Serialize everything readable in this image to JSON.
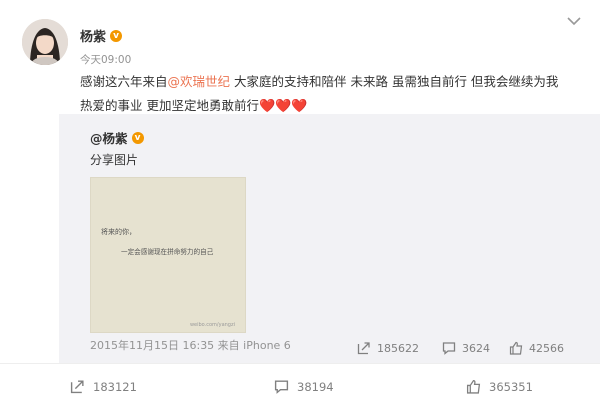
{
  "post": {
    "username": "杨紫",
    "time": "今天09:00",
    "text_before": "感谢这六年来自",
    "mention": "@欢瑞世纪",
    "text_after_line1": " 大家庭的支持和陪伴 未来路 虽需独自前行 但我会继续为我",
    "text_line2": "热爱的事业 更加坚定地勇敢前行",
    "hearts": "❤️❤️❤️"
  },
  "original": {
    "author": "@杨紫",
    "text": "分享图片",
    "image_line1": "将来的你，",
    "image_line2": "一定会感谢现在拼命努力的自己",
    "image_watermark": "weibo.com/yangzi",
    "date": "2015年11月15日 16:35 来自 iPhone 6",
    "reposts": "185622",
    "comments": "3624",
    "likes": "42566"
  },
  "footer": {
    "reposts": "183121",
    "comments": "38194",
    "likes": "365351"
  },
  "colors": {
    "link": "#eb7350",
    "muted": "#939393",
    "repost_bg": "#f2f2f5",
    "heart": "#e8202b",
    "vip_badge": "#f39800"
  },
  "icons": {
    "menu": "chevron-down-icon",
    "repost": "repost-icon",
    "comment": "comment-icon",
    "like": "thumbs-up-icon",
    "verified": "vip-badge-icon"
  }
}
